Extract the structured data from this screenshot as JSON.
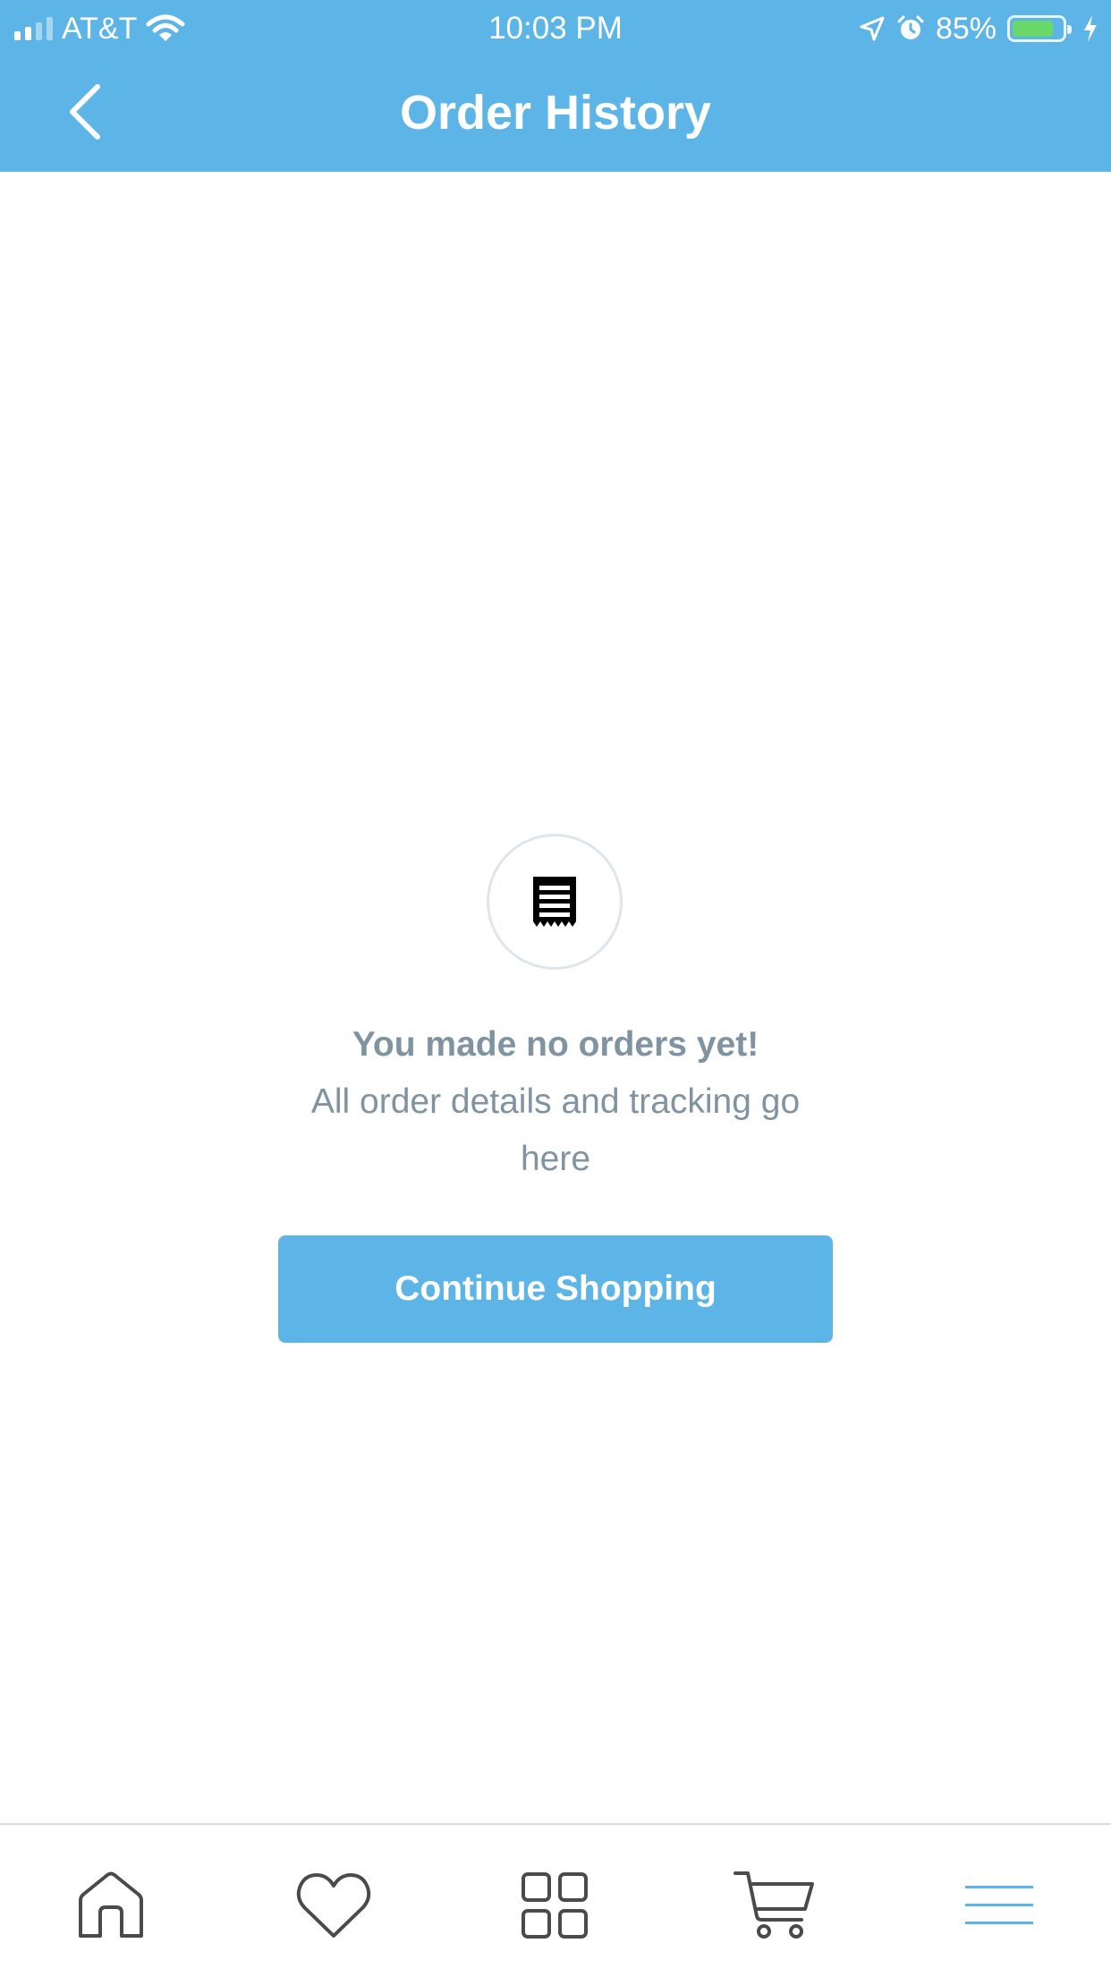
{
  "status_bar": {
    "carrier": "AT&T",
    "time": "10:03 PM",
    "battery_percent": "85%",
    "battery_level": 0.85,
    "icons": [
      "signal-icon",
      "wifi-icon",
      "location-icon",
      "alarm-icon",
      "battery-icon",
      "charging-icon"
    ]
  },
  "header": {
    "title": "Order History",
    "back_icon": "chevron-left-icon"
  },
  "empty_state": {
    "icon": "receipt-icon",
    "title": "You made no orders yet!",
    "subtitle": "All order details and tracking go here",
    "button_label": "Continue Shopping"
  },
  "tab_bar": {
    "items": [
      {
        "icon": "home-icon"
      },
      {
        "icon": "heart-icon"
      },
      {
        "icon": "grid-icon"
      },
      {
        "icon": "cart-icon"
      },
      {
        "icon": "menu-icon",
        "active": true
      }
    ]
  },
  "colors": {
    "accent": "#5DB4E7",
    "muted_text": "#7F93A0",
    "tab_icon": "#4A4A4A",
    "battery_green": "#6BD96A"
  }
}
